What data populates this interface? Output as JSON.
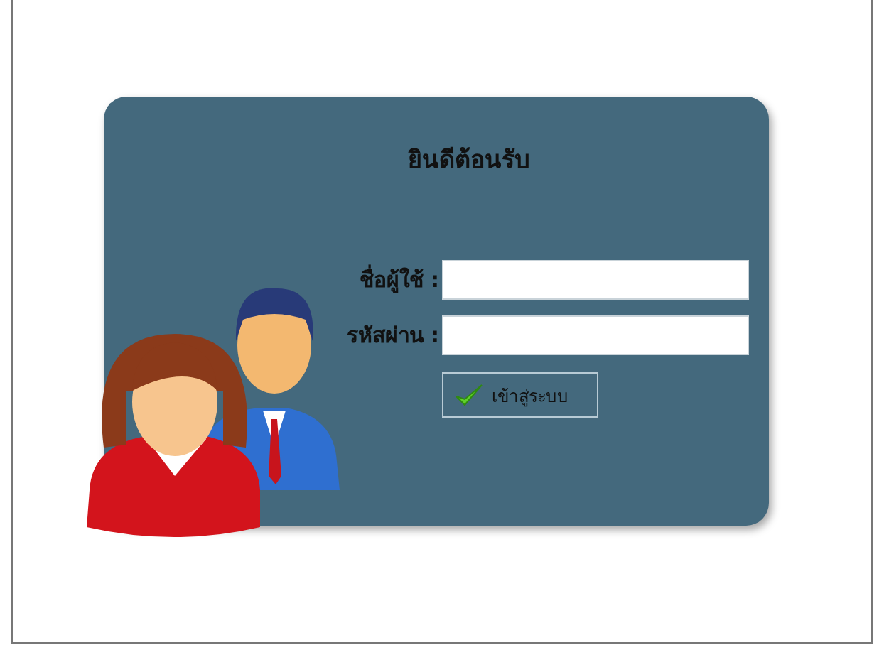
{
  "login": {
    "title": "ยินดีต้อนรับ",
    "fields": [
      {
        "label": "ชื่อผู้ใช้ :"
      },
      {
        "label": "รหัสผ่าน :"
      }
    ],
    "submit": {
      "label": "เข้าสู่ระบบ"
    }
  }
}
